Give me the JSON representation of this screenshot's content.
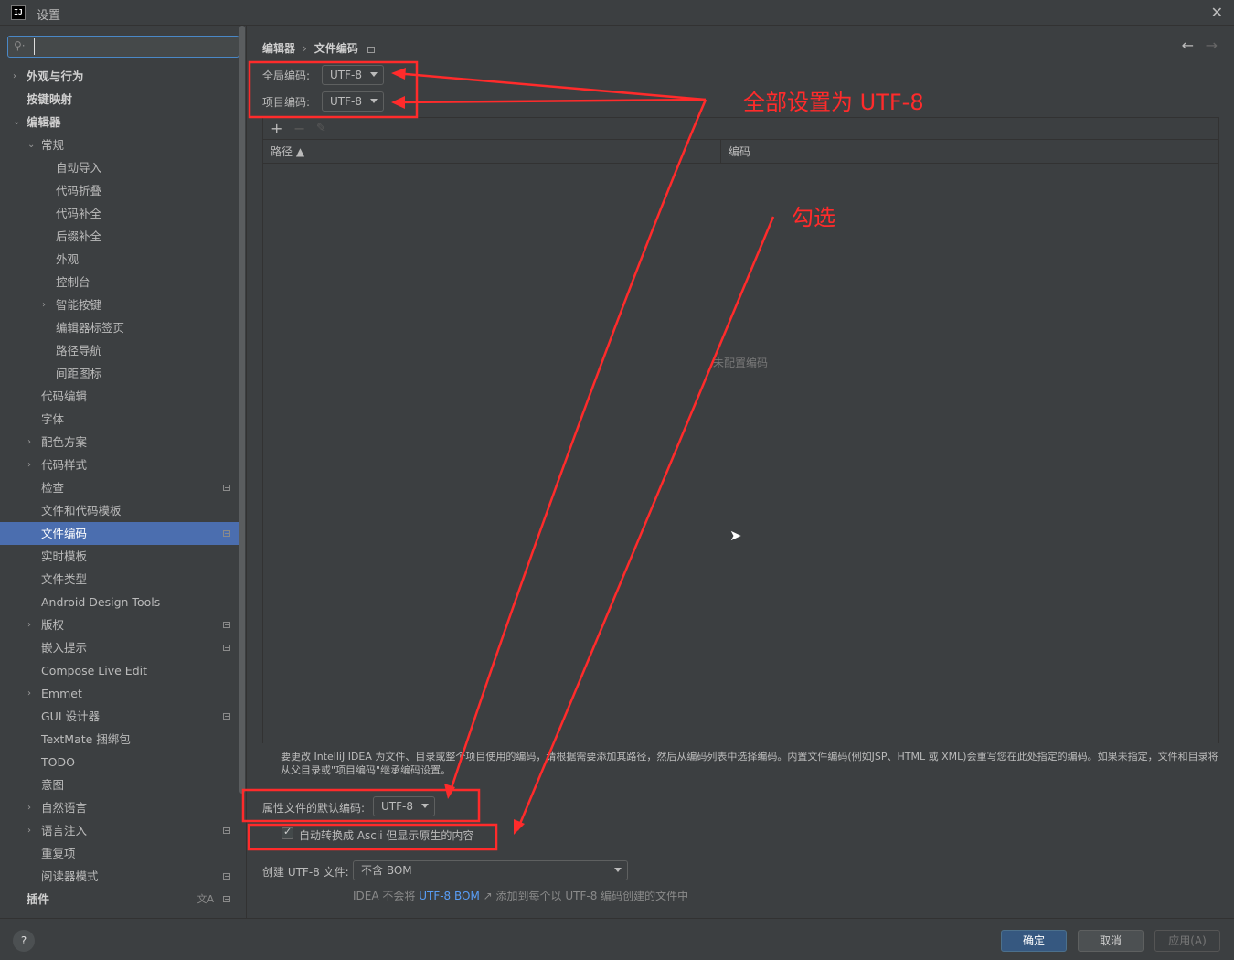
{
  "window": {
    "title": "设置",
    "logo": "IJ"
  },
  "search": {
    "placeholder": "",
    "icon": "search-icon"
  },
  "sidebar": {
    "items": [
      {
        "label": "外观与行为",
        "level": 0,
        "arrow": "›",
        "bold": true,
        "badge": false
      },
      {
        "label": "按键映射",
        "level": 0,
        "arrow": "",
        "bold": true,
        "badge": false
      },
      {
        "label": "编辑器",
        "level": 0,
        "arrow": "⌄",
        "bold": true,
        "badge": false
      },
      {
        "label": "常规",
        "level": 1,
        "arrow": "⌄",
        "bold": false,
        "badge": false
      },
      {
        "label": "自动导入",
        "level": 2,
        "arrow": "",
        "bold": false,
        "badge": false
      },
      {
        "label": "代码折叠",
        "level": 2,
        "arrow": "",
        "bold": false,
        "badge": false
      },
      {
        "label": "代码补全",
        "level": 2,
        "arrow": "",
        "bold": false,
        "badge": false
      },
      {
        "label": "后缀补全",
        "level": 2,
        "arrow": "",
        "bold": false,
        "badge": false
      },
      {
        "label": "外观",
        "level": 2,
        "arrow": "",
        "bold": false,
        "badge": false
      },
      {
        "label": "控制台",
        "level": 2,
        "arrow": "",
        "bold": false,
        "badge": false
      },
      {
        "label": "智能按键",
        "level": 2,
        "arrow": "›",
        "bold": false,
        "badge": false
      },
      {
        "label": "编辑器标签页",
        "level": 2,
        "arrow": "",
        "bold": false,
        "badge": false
      },
      {
        "label": "路径导航",
        "level": 2,
        "arrow": "",
        "bold": false,
        "badge": false
      },
      {
        "label": "间距图标",
        "level": 2,
        "arrow": "",
        "bold": false,
        "badge": false
      },
      {
        "label": "代码编辑",
        "level": 1,
        "arrow": "",
        "bold": false,
        "badge": false
      },
      {
        "label": "字体",
        "level": 1,
        "arrow": "",
        "bold": false,
        "badge": false
      },
      {
        "label": "配色方案",
        "level": 1,
        "arrow": "›",
        "bold": false,
        "badge": false
      },
      {
        "label": "代码样式",
        "level": 1,
        "arrow": "›",
        "bold": false,
        "badge": false
      },
      {
        "label": "检查",
        "level": 1,
        "arrow": "",
        "bold": false,
        "badge": true
      },
      {
        "label": "文件和代码模板",
        "level": 1,
        "arrow": "",
        "bold": false,
        "badge": false
      },
      {
        "label": "文件编码",
        "level": 1,
        "arrow": "",
        "bold": false,
        "badge": true,
        "selected": true
      },
      {
        "label": "实时模板",
        "level": 1,
        "arrow": "",
        "bold": false,
        "badge": false
      },
      {
        "label": "文件类型",
        "level": 1,
        "arrow": "",
        "bold": false,
        "badge": false
      },
      {
        "label": "Android Design Tools",
        "level": 1,
        "arrow": "",
        "bold": false,
        "badge": false
      },
      {
        "label": "版权",
        "level": 1,
        "arrow": "›",
        "bold": false,
        "badge": true
      },
      {
        "label": "嵌入提示",
        "level": 1,
        "arrow": "",
        "bold": false,
        "badge": true
      },
      {
        "label": "Compose Live Edit",
        "level": 1,
        "arrow": "",
        "bold": false,
        "badge": false
      },
      {
        "label": "Emmet",
        "level": 1,
        "arrow": "›",
        "bold": false,
        "badge": false
      },
      {
        "label": "GUI 设计器",
        "level": 1,
        "arrow": "",
        "bold": false,
        "badge": true
      },
      {
        "label": "TextMate 捆绑包",
        "level": 1,
        "arrow": "",
        "bold": false,
        "badge": false
      },
      {
        "label": "TODO",
        "level": 1,
        "arrow": "",
        "bold": false,
        "badge": false
      },
      {
        "label": "意图",
        "level": 1,
        "arrow": "",
        "bold": false,
        "badge": false
      },
      {
        "label": "自然语言",
        "level": 1,
        "arrow": "›",
        "bold": false,
        "badge": false
      },
      {
        "label": "语言注入",
        "level": 1,
        "arrow": "›",
        "bold": false,
        "badge": true
      },
      {
        "label": "重复项",
        "level": 1,
        "arrow": "",
        "bold": false,
        "badge": false
      },
      {
        "label": "阅读器模式",
        "level": 1,
        "arrow": "",
        "bold": false,
        "badge": true
      },
      {
        "label": "插件",
        "level": 0,
        "arrow": "",
        "bold": true,
        "badge": true,
        "translate": "文A"
      }
    ]
  },
  "main": {
    "breadcrumb": {
      "parent": "编辑器",
      "separator": "›",
      "current": "文件编码"
    },
    "global_encoding": {
      "label": "全局编码:",
      "value": "UTF-8"
    },
    "project_encoding": {
      "label": "项目编码:",
      "value": "UTF-8"
    },
    "table": {
      "toolbar": {
        "add": "+",
        "remove": "−",
        "edit": "✎"
      },
      "columns": [
        "路径 ▲",
        "编码"
      ],
      "empty_text": "未配置编码"
    },
    "description": "要更改 IntelliJ IDEA 为文件、目录或整个项目使用的编码，请根据需要添加其路径，然后从编码列表中选择编码。内置文件编码(例如JSP、HTML 或 XML)会重写您在此处指定的编码。如果未指定，文件和目录将从父目录或\"项目编码\"继承编码设置。",
    "properties_encoding": {
      "label": "属性文件的默认编码:",
      "value": "UTF-8"
    },
    "native_ascii": {
      "label": "自动转换成 Ascii 但显示原生的内容",
      "checked": true
    },
    "bom": {
      "label": "创建 UTF-8 文件:",
      "value": "不含 BOM"
    },
    "hint": {
      "prefix": "IDEA 不会将 ",
      "link": "UTF-8 BOM",
      "link_arrow": "↗",
      "suffix": " 添加到每个以 UTF-8 编码创建的文件中"
    }
  },
  "annotations": {
    "set_utf8": "全部设置为 UTF-8",
    "check": "勾选",
    "color": "#ff2b2b"
  },
  "footer": {
    "help": "?",
    "ok": "确定",
    "cancel": "取消",
    "apply": "应用(A)"
  },
  "colors": {
    "selection": "#4b6eaf",
    "primary_button": "#365880",
    "link": "#589df6",
    "annotation": "#ff2b2b"
  }
}
